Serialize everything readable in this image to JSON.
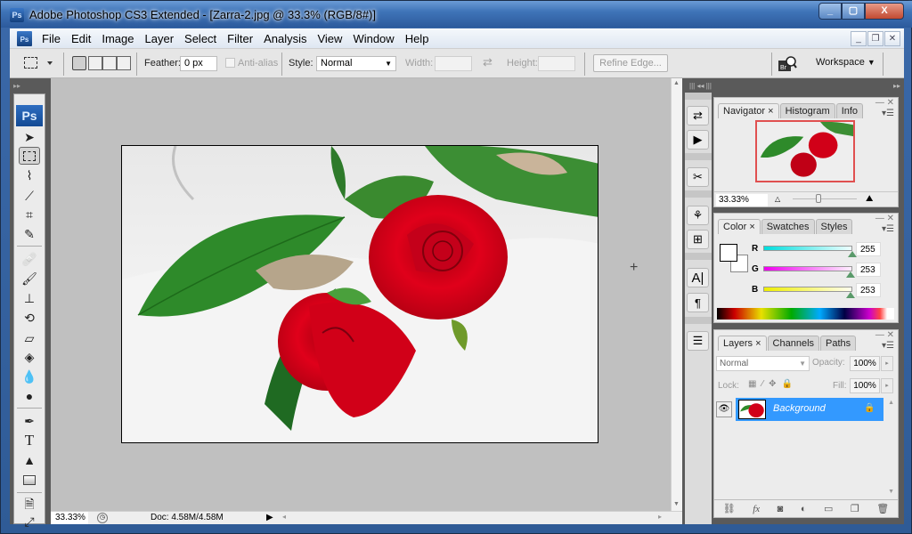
{
  "window": {
    "title": "Adobe Photoshop CS3 Extended - [Zarra-2.jpg @ 33.3% (RGB/8#)]",
    "app_icon": "Ps",
    "controls": {
      "minimize": "minimize-icon",
      "maximize": "maximize-icon",
      "close": "close-icon"
    }
  },
  "menubar": {
    "items": [
      "File",
      "Edit",
      "Image",
      "Layer",
      "Select",
      "Filter",
      "Analysis",
      "View",
      "Window",
      "Help"
    ],
    "doc_controls": [
      "minimize",
      "restore",
      "close"
    ]
  },
  "options": {
    "feather_label": "Feather:",
    "feather_value": "0 px",
    "antialias_label": "Anti-alias",
    "style_label": "Style:",
    "style_value": "Normal",
    "width_label": "Width:",
    "width_value": "",
    "height_label": "Height:",
    "height_value": "",
    "refine_edge": "Refine Edge...",
    "workspace": "Workspace"
  },
  "toolbox": {
    "logo": "Ps",
    "tools": [
      "move",
      "rectangular-marquee",
      "lasso",
      "quick-selection",
      "crop",
      "slice",
      "spot-healing",
      "brush",
      "clone-stamp",
      "history-brush",
      "eraser",
      "paint-bucket",
      "blur",
      "dodge",
      "pen",
      "type",
      "path-selection",
      "rectangle",
      "notes",
      "eyedropper"
    ],
    "selected": "rectangular-marquee"
  },
  "document": {
    "filename": "Zarra-2.jpg",
    "zoom": "33.33%",
    "doc_size": "Doc: 4.58M/4.58M"
  },
  "navigator": {
    "tabs": [
      "Navigator",
      "Histogram",
      "Info"
    ],
    "active_tab": "Navigator",
    "zoom": "33.33%"
  },
  "color": {
    "tabs": [
      "Color",
      "Swatches",
      "Styles"
    ],
    "active_tab": "Color",
    "channels": [
      {
        "label": "R",
        "value": "255"
      },
      {
        "label": "G",
        "value": "253"
      },
      {
        "label": "B",
        "value": "253"
      }
    ],
    "foreground": "#ffffff",
    "background": "#ffffff"
  },
  "layers": {
    "tabs": [
      "Layers",
      "Channels",
      "Paths"
    ],
    "active_tab": "Layers",
    "blend_mode": "Normal",
    "opacity_label": "Opacity:",
    "opacity": "100%",
    "lock_label": "Lock:",
    "fill_label": "Fill:",
    "fill": "100%",
    "items": [
      {
        "name": "Background",
        "visible": true,
        "locked": true,
        "selected": true
      }
    ]
  },
  "colors": {
    "accent": "#3399ff",
    "canvas_bg": "#c0c0c0",
    "titlebar": "#3f74b8"
  }
}
